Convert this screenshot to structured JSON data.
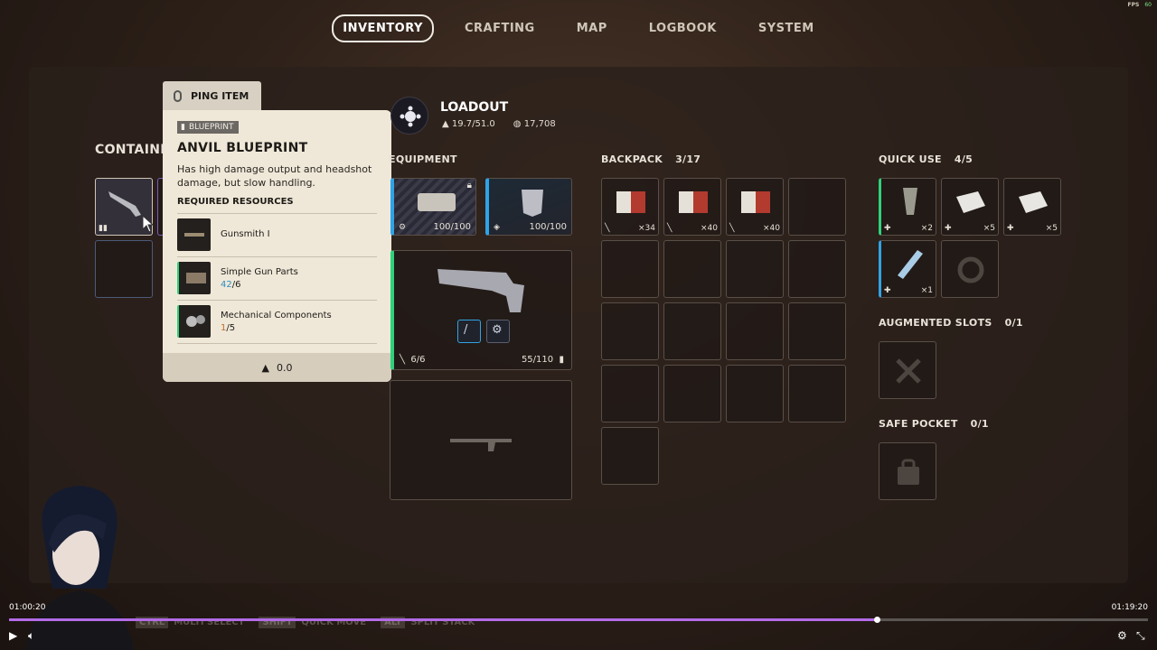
{
  "fps": {
    "label": "FPS",
    "value": "60"
  },
  "nav": {
    "tabs": [
      "INVENTORY",
      "CRAFTING",
      "MAP",
      "LOGBOOK",
      "SYSTEM"
    ],
    "active": 0
  },
  "container": {
    "label": "CONTAINER"
  },
  "ping": {
    "label": "PING ITEM"
  },
  "tooltip": {
    "badge": "BLUEPRINT",
    "title": "ANVIL BLUEPRINT",
    "description": "Has high damage output and headshot damage, but slow handling.",
    "required_label": "REQUIRED RESOURCES",
    "resources": [
      {
        "name": "Gunsmith I",
        "have": "",
        "need": ""
      },
      {
        "name": "Simple Gun Parts",
        "have": "42",
        "need": "/6"
      },
      {
        "name": "Mechanical Components",
        "have": "1",
        "need": "/5"
      }
    ],
    "weight": "0.0"
  },
  "loadout": {
    "title": "LOADOUT",
    "weight": "19.7/51.0",
    "coins": "17,708"
  },
  "equipment": {
    "label": "EQUIPMENT",
    "augment_durability": "100/100",
    "shield_durability": "100/100",
    "weapon_ammo": "6/6",
    "weapon_durability": "55/110"
  },
  "backpack": {
    "label": "BACKPACK",
    "count": "3/17",
    "qtys": [
      "×34",
      "×40",
      "×40"
    ]
  },
  "quick_use": {
    "label": "QUICK USE",
    "count": "4/5",
    "qtys": [
      "×2",
      "×5",
      "×5",
      "×1"
    ]
  },
  "augmented": {
    "label": "AUGMENTED SLOTS",
    "count": "0/1"
  },
  "safe_pocket": {
    "label": "SAFE POCKET",
    "count": "0/1"
  },
  "hints": [
    {
      "key": "CTRL",
      "label": "MULTI SELECT"
    },
    {
      "key": "SHIFT",
      "label": "QUICK MOVE"
    },
    {
      "key": "ALT",
      "label": "SPLIT STACK"
    }
  ],
  "video": {
    "current": "01:00:20",
    "total": "01:19:20",
    "progress": 0.762
  },
  "colors": {
    "accent_purple": "#b36be8",
    "rarity_green": "#2fd17a",
    "rarity_blue": "#2fa3e6",
    "tooltip_bg": "#efe8d8"
  }
}
